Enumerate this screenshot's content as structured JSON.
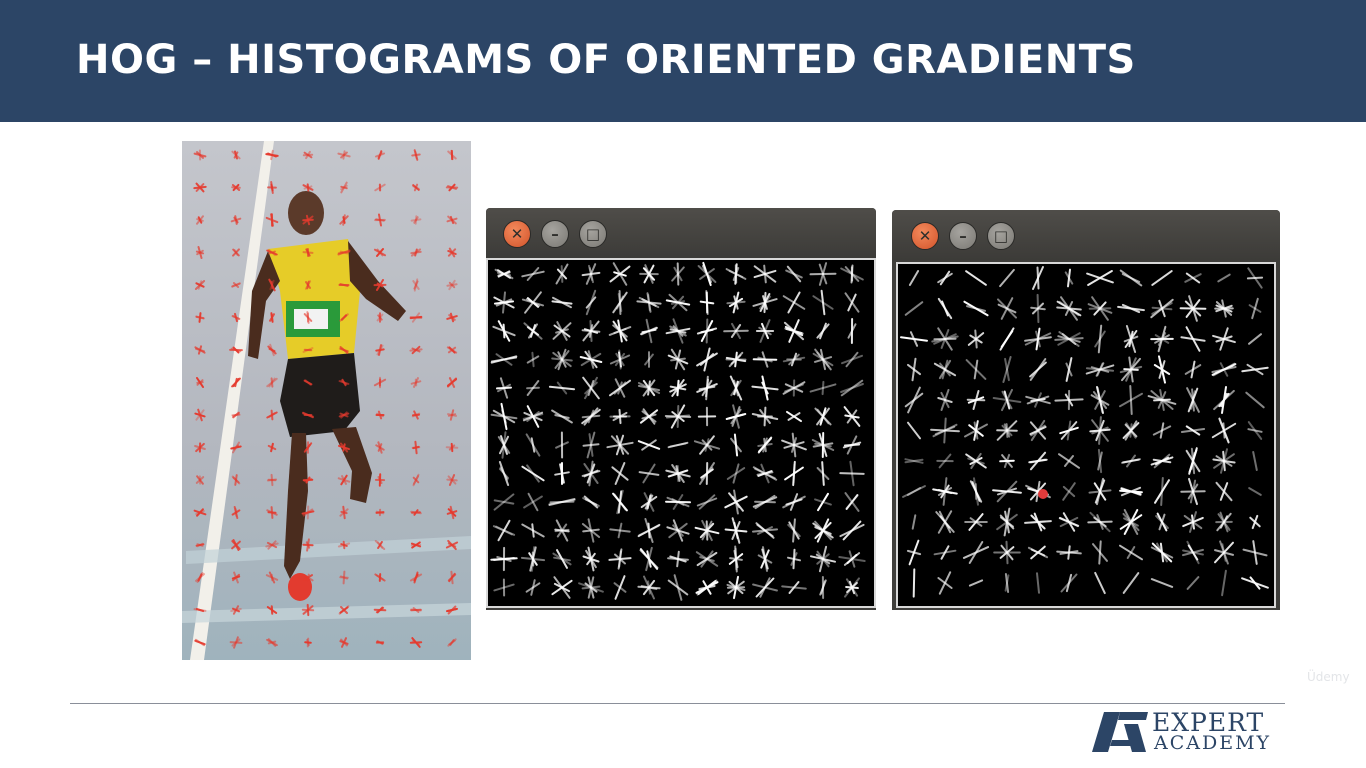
{
  "slide": {
    "title": "HOG – HISTOGRAMS OF ORIENTED GRADIENTS",
    "watermark": "Üdemy",
    "colors": {
      "header_bg": "#2c4566",
      "hog_vector": "#e53a2e",
      "window_close": "#e0683b"
    }
  },
  "windows": [
    {
      "buttons": [
        "close-icon",
        "minimize-icon",
        "maximize-icon"
      ]
    },
    {
      "buttons": [
        "close-icon",
        "minimize-icon",
        "maximize-icon"
      ]
    }
  ],
  "logo": {
    "line1": "EXPERT",
    "line2": "ACADEMY"
  }
}
